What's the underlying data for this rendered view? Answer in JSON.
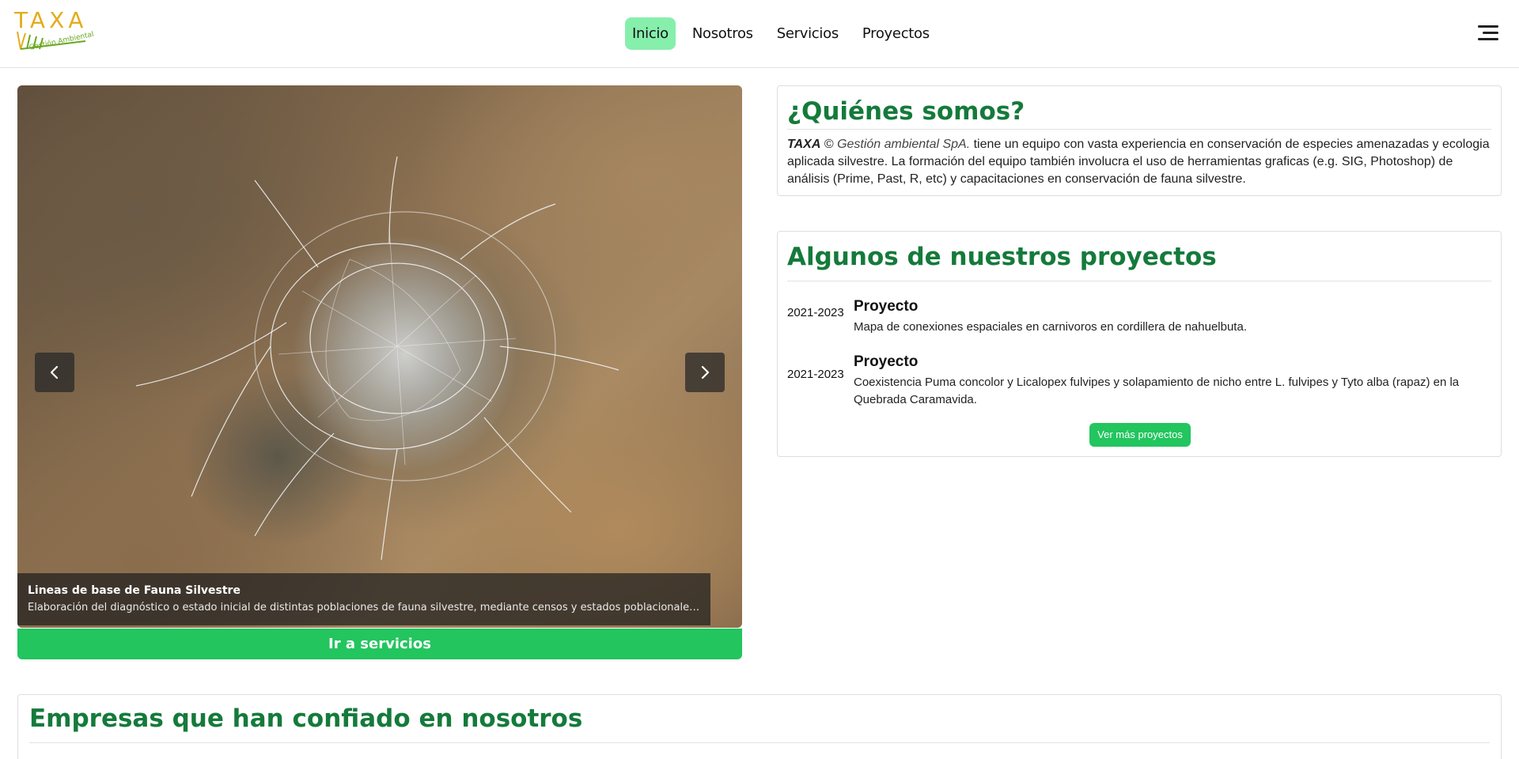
{
  "header": {
    "logo_text": "TAXA",
    "logo_subtitle": "Gestión Ambiental",
    "nav": [
      {
        "label": "Inicio",
        "active": true
      },
      {
        "label": "Nosotros",
        "active": false
      },
      {
        "label": "Servicios",
        "active": false
      },
      {
        "label": "Proyectos",
        "active": false
      }
    ],
    "menu_icon": "hamburger-menu-icon"
  },
  "carousel": {
    "caption_title": "Lineas de base de Fauna Silvestre",
    "caption_text": "Elaboración del diagnóstico o estado inicial de distintas poblaciones de fauna silvestre, mediante censos y estados poblacionales,...",
    "prev_icon": "chevron-left-icon",
    "next_icon": "chevron-right-icon",
    "button_label": "Ir a servicios"
  },
  "about": {
    "title": "¿Quiénes somos?",
    "brand": "TAXA",
    "copyright": " © ",
    "company": "Gestión ambiental SpA.",
    "text": " tiene un equipo con vasta experiencia en conservación de especies amenazadas y ecologia aplicada silvestre. La formación del equipo también involucra el uso de herramientas graficas (e.g. SIG, Photoshop) de análisis (Prime, Past, R, etc) y capacitaciones en conservación de fauna silvestre."
  },
  "projects": {
    "title": "Algunos de nuestros proyectos",
    "items": [
      {
        "year": "2021-2023",
        "title": "Proyecto",
        "description": "Mapa de conexiones espaciales en carnivoros en cordillera de nahuelbuta."
      },
      {
        "year": "2021-2023",
        "title": "Proyecto",
        "description": "Coexistencia Puma concolor y Licalopex fulvipes y solapamiento de nicho entre L. fulvipes y Tyto alba (rapaz) en la Quebrada Caramavida."
      }
    ],
    "more_label": "Ver más proyectos"
  },
  "companies": {
    "title": "Empresas que han confiado en nosotros"
  },
  "colors": {
    "accent_green": "#22c55e",
    "active_nav": "#86efac",
    "heading_green": "#157a3b",
    "logo_gold": "#e2ac1c"
  }
}
